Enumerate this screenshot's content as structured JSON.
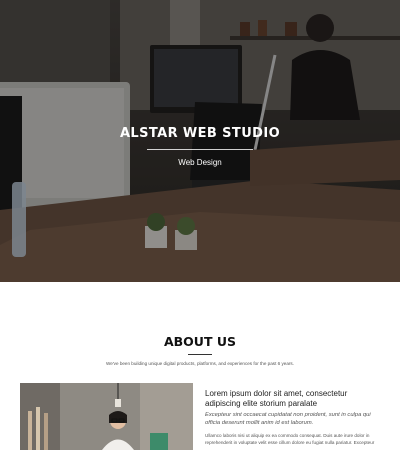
{
  "hero": {
    "title": "ALSTAR WEB STUDIO",
    "subtitle": "Web Design"
  },
  "about": {
    "title": "ABOUT US",
    "tagline": "We've been building unique digital products, platforms, and experiences for the past 6 years.",
    "heading": "Lorem ipsum dolor sit amet, consectetur adipiscing elite storium paralate",
    "quote": "Excepteur sint occaecat cupidatat non proident, sunt in culpa qui officia deserunt mollit anim id est laborum.",
    "body": "Ullamco laboris nisi ut aliquip ex ea commodo consequat. Duis aute irure dolor in reprehenderit in voluptate velit esse cillum dolore eu fugiat nulla pariatur. Excepteur"
  }
}
